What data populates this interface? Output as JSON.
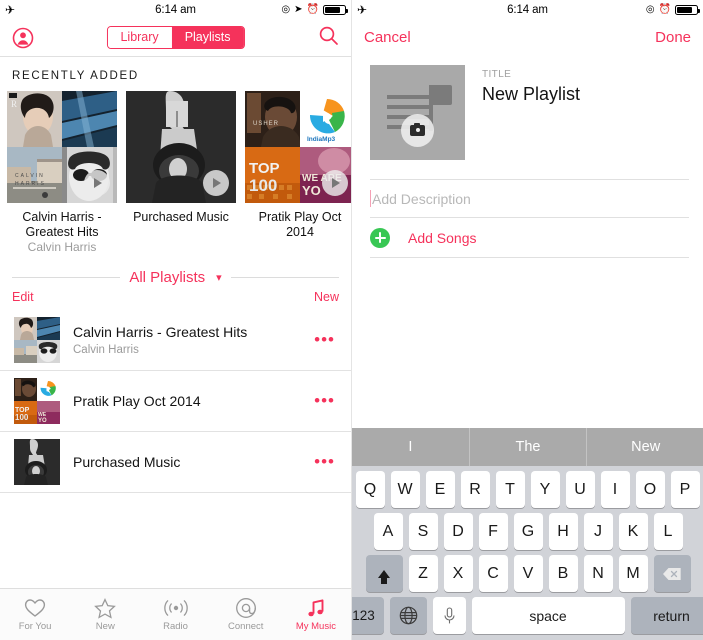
{
  "statusbar": {
    "time": "6:14 am",
    "icons_left": [
      "airplane-mode-icon"
    ],
    "icons_right": [
      "do-not-disturb-icon",
      "location-arrow-icon",
      "alarm-clock-icon",
      "battery-icon"
    ]
  },
  "colors": {
    "accent": "#f5325b",
    "green": "#38c754",
    "muted": "#9b9b9b",
    "keyboard_bg": "#d1d3d8",
    "suggestion_bar": "#aaaaaa"
  },
  "left_panel": {
    "nav": {
      "profile_icon": "account-circle-icon",
      "search_icon": "search-icon",
      "segments": [
        {
          "label": "Library",
          "selected": false
        },
        {
          "label": "Playlists",
          "selected": true
        }
      ]
    },
    "recently_added": {
      "heading": "RECENTLY ADDED",
      "tiles": [
        {
          "title": "Calvin Harris - Greatest Hits",
          "subtitle": "Calvin Harris",
          "art": "grid4",
          "play": true
        },
        {
          "title": "Purchased Music",
          "subtitle": "",
          "art": "single",
          "play": true
        },
        {
          "title": "Pratik Play Oct 2014",
          "subtitle": "",
          "art": "grid4b",
          "play": true
        }
      ]
    },
    "all_playlists": {
      "heading": "All Playlists",
      "chevron": "chevron-down-icon",
      "edit_label": "Edit",
      "new_label": "New",
      "rows": [
        {
          "name": "Calvin Harris - Greatest Hits",
          "artist": "Calvin Harris",
          "art": "grid4",
          "more": "•••"
        },
        {
          "name": "Pratik Play Oct 2014",
          "artist": "",
          "art": "grid4b",
          "more": "•••"
        },
        {
          "name": "Purchased Music",
          "artist": "",
          "art": "single",
          "more": "•••"
        }
      ]
    },
    "tabbar": [
      {
        "label": "For You",
        "icon": "heart-icon",
        "active": false
      },
      {
        "label": "New",
        "icon": "star-icon",
        "active": false
      },
      {
        "label": "Radio",
        "icon": "radio-waves-icon",
        "active": false
      },
      {
        "label": "Connect",
        "icon": "at-sign-icon",
        "active": false
      },
      {
        "label": "My Music",
        "icon": "music-note-icon",
        "active": true
      }
    ]
  },
  "right_panel": {
    "nav": {
      "cancel_label": "Cancel",
      "done_label": "Done"
    },
    "cover": {
      "icon": "playlist-artwork-placeholder",
      "camera_icon": "camera-icon"
    },
    "title_label": "TITLE",
    "title_value": "New Playlist",
    "description_placeholder": "Add Description",
    "description_value": "",
    "add_songs": {
      "label": "Add Songs",
      "icon": "plus-circle-icon"
    },
    "keyboard": {
      "suggestions": [
        "I",
        "The",
        "New"
      ],
      "row1": [
        "Q",
        "W",
        "E",
        "R",
        "T",
        "Y",
        "U",
        "I",
        "O",
        "P"
      ],
      "row2": [
        "A",
        "S",
        "D",
        "F",
        "G",
        "H",
        "J",
        "K",
        "L"
      ],
      "row3": [
        "Z",
        "X",
        "C",
        "V",
        "B",
        "N",
        "M"
      ],
      "shift_icon": "shift-icon",
      "backspace_icon": "backspace-icon",
      "numbers_label": "123",
      "globe_icon": "globe-icon",
      "mic_icon": "microphone-icon",
      "space_label": "space",
      "return_label": "return"
    }
  }
}
